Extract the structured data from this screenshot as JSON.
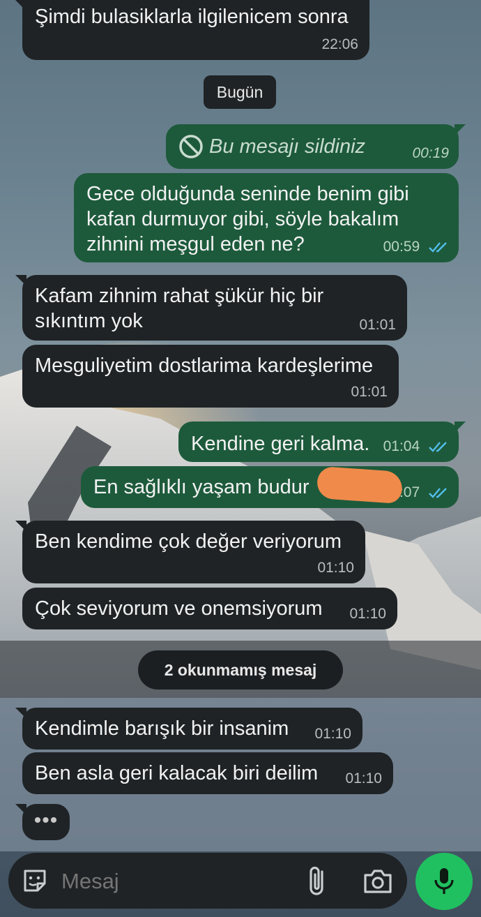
{
  "chat": {
    "messages": [
      {
        "dir": "in",
        "text": "Şimdi bulasiklarla ilgilenicem sonra",
        "time": "22:06"
      },
      {
        "dir": "out",
        "text": "Bu mesajı sildiniz",
        "time": "00:19",
        "deleted": true
      },
      {
        "dir": "out",
        "text": "Gece olduğunda seninde benim gibi\nkafan durmuyor gibi, söyle bakalım\nzihnini meşgul eden ne?",
        "time": "00:59"
      },
      {
        "dir": "in",
        "text": "Kafam zihnim rahat şükür hiç bir\nsıkıntım yok",
        "time": "01:01"
      },
      {
        "dir": "in",
        "text": "Mesguliyetim dostlarima kardeşlerime",
        "time": "01:01"
      },
      {
        "dir": "out",
        "text": "Kendine geri kalma.",
        "time": "01:04"
      },
      {
        "dir": "out",
        "text": "En sağlıklı yaşam budur",
        "time": "01:07"
      },
      {
        "dir": "in",
        "text": "Ben kendime çok değer veriyorum",
        "time": "01:10"
      },
      {
        "dir": "in",
        "text": "Çok seviyorum ve onemsiyorum",
        "time": "01:10"
      },
      {
        "dir": "in",
        "text": "Kendimle barışık bir insanim",
        "time": "01:10"
      },
      {
        "dir": "in",
        "text": "Ben asla geri kalacak biri deilim",
        "time": "01:10"
      }
    ],
    "date_chip": "Bugün",
    "unread_chip": "2 okunmamış mesaj",
    "typing_indicator": "•••"
  },
  "composer": {
    "placeholder": "Mesaj",
    "icons": [
      "sticker-icon",
      "paperclip-icon",
      "camera-icon",
      "microphone-icon"
    ]
  },
  "colors": {
    "incoming_bubble": "#1f2326",
    "outgoing_bubble": "#1d5a3b",
    "read_ticks": "#53bdeb",
    "mic_button": "#20c060"
  }
}
